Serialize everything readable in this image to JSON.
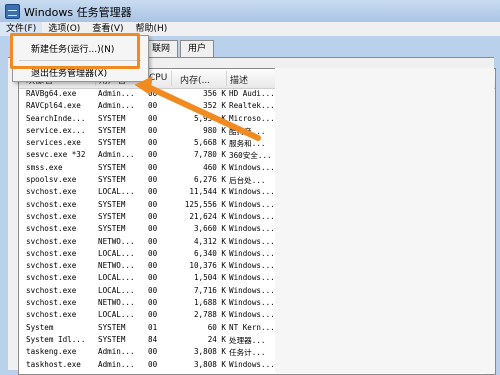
{
  "window": {
    "title": "Windows 任务管理器"
  },
  "menubar": {
    "items": [
      {
        "label": "文件(F)"
      },
      {
        "label": "选项(O)"
      },
      {
        "label": "查看(V)"
      },
      {
        "label": "帮助(H)"
      }
    ]
  },
  "dropdown": {
    "items": [
      {
        "label": "新建任务(运行...)(N)"
      },
      {
        "label": "退出任务管理器(X)"
      }
    ]
  },
  "tabs": [
    {
      "label": "联网"
    },
    {
      "label": "用户"
    }
  ],
  "table": {
    "headers": [
      "映像名",
      "用户名",
      "CPU",
      "内存(...",
      "描述"
    ],
    "rows": [
      [
        "RAVBg64.exe",
        "Admin...",
        "00",
        "356 K",
        "HD Audi..."
      ],
      [
        "RAVCpl64.exe",
        "Admin...",
        "00",
        "352 K",
        "Realtek..."
      ],
      [
        "SearchInde...",
        "SYSTEM",
        "00",
        "5,956 K",
        "Microso..."
      ],
      [
        "service.ex...",
        "SYSTEM",
        "00",
        "980 K",
        "酷狗音..."
      ],
      [
        "services.exe",
        "SYSTEM",
        "00",
        "5,668 K",
        "服务和..."
      ],
      [
        "sesvc.exe *32",
        "Admin...",
        "00",
        "7,780 K",
        "360安全..."
      ],
      [
        "smss.exe",
        "SYSTEM",
        "00",
        "460 K",
        "Windows..."
      ],
      [
        "spoolsv.exe",
        "SYSTEM",
        "00",
        "6,276 K",
        "后台处..."
      ],
      [
        "svchost.exe",
        "LOCAL...",
        "00",
        "11,544 K",
        "Windows..."
      ],
      [
        "svchost.exe",
        "SYSTEM",
        "00",
        "125,556 K",
        "Windows..."
      ],
      [
        "svchost.exe",
        "SYSTEM",
        "00",
        "21,624 K",
        "Windows..."
      ],
      [
        "svchost.exe",
        "SYSTEM",
        "00",
        "3,660 K",
        "Windows..."
      ],
      [
        "svchost.exe",
        "NETWO...",
        "00",
        "4,312 K",
        "Windows..."
      ],
      [
        "svchost.exe",
        "LOCAL...",
        "00",
        "6,340 K",
        "Windows..."
      ],
      [
        "svchost.exe",
        "NETWO...",
        "00",
        "10,376 K",
        "Windows..."
      ],
      [
        "svchost.exe",
        "LOCAL...",
        "00",
        "1,504 K",
        "Windows..."
      ],
      [
        "svchost.exe",
        "LOCAL...",
        "00",
        "7,716 K",
        "Windows..."
      ],
      [
        "svchost.exe",
        "NETWO...",
        "00",
        "1,688 K",
        "Windows..."
      ],
      [
        "svchost.exe",
        "LOCAL...",
        "00",
        "2,788 K",
        "Windows..."
      ],
      [
        "System",
        "SYSTEM",
        "01",
        "60 K",
        "NT Kern..."
      ],
      [
        "System Idl...",
        "SYSTEM",
        "84",
        "24 K",
        "处理器..."
      ],
      [
        "taskeng.exe",
        "Admin...",
        "00",
        "3,808 K",
        "任务计..."
      ],
      [
        "taskhost.exe",
        "Admin...",
        "00",
        "3,808 K",
        "Windows..."
      ]
    ]
  },
  "colors": {
    "highlight": "#f28a22",
    "arrow": "#f28a22"
  }
}
